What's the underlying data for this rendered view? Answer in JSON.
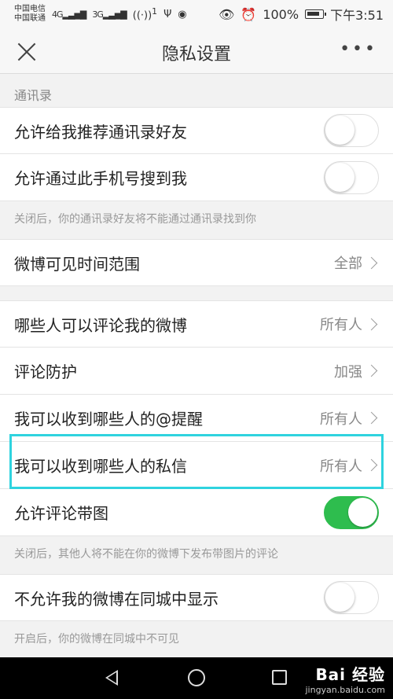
{
  "status_bar": {
    "carrier1": "中国电信",
    "carrier2": "中国联通",
    "signal1": "4G",
    "signal2": "3G",
    "hotspot": "1",
    "battery": "100%",
    "time": "下午3:51"
  },
  "header": {
    "title": "隐私设置"
  },
  "sections": {
    "contacts_title": "通讯录"
  },
  "rows": {
    "recommend_contacts": {
      "label": "允许给我推荐通讯录好友",
      "toggle_on": false
    },
    "search_by_phone": {
      "label": "允许通过此手机号搜到我",
      "toggle_on": false
    },
    "contacts_note": "关闭后，你的通讯录好友将不能通过通讯录找到你",
    "visible_range": {
      "label": "微博可见时间范围",
      "value": "全部"
    },
    "who_can_comment": {
      "label": "哪些人可以评论我的微博",
      "value": "所有人"
    },
    "comment_protection": {
      "label": "评论防护",
      "value": "加强"
    },
    "mention_from": {
      "label": "我可以收到哪些人的@提醒",
      "value": "所有人"
    },
    "messages_from": {
      "label": "我可以收到哪些人的私信",
      "value": "所有人"
    },
    "comment_images": {
      "label": "允许评论带图",
      "toggle_on": true
    },
    "comment_images_note": "关闭后，其他人将不能在你的微博下发布带图片的评论",
    "hide_local": {
      "label": "不允许我的微博在同城中显示",
      "toggle_on": false
    },
    "hide_local_note": "开启后，你的微博在同城中不可见"
  },
  "watermark": {
    "main": "Bai 经验",
    "sub": "jingyan.baidu.com"
  },
  "colors": {
    "toggle_on": "#2ebd4e",
    "highlight": "#2fd3df"
  }
}
